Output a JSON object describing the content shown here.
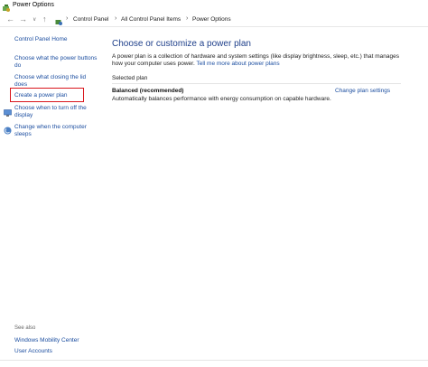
{
  "window": {
    "title": "Power Options"
  },
  "address": {
    "crumbs": [
      "Control Panel",
      "All Control Panel Items",
      "Power Options"
    ]
  },
  "sidebar": {
    "home": "Control Panel Home",
    "items": [
      {
        "label": "Choose what the power buttons do"
      },
      {
        "label": "Choose what closing the lid does"
      },
      {
        "label": "Create a power plan"
      },
      {
        "label": "Choose when to turn off the display"
      },
      {
        "label": "Change when the computer sleeps"
      }
    ],
    "see_also": {
      "heading": "See also",
      "links": [
        "Windows Mobility Center",
        "User Accounts"
      ]
    }
  },
  "main": {
    "title": "Choose or customize a power plan",
    "description": "A power plan is a collection of hardware and system settings (like display brightness, sleep, etc.) that manages how your computer uses power.",
    "description_link": "Tell me more about power plans",
    "group_label": "Selected plan",
    "plan": {
      "name": "Balanced (recommended)",
      "change_link": "Change plan settings",
      "description": "Automatically balances performance with energy consumption on capable hardware."
    }
  },
  "colors": {
    "link": "#1c4ea0",
    "title": "#1e3f8a",
    "highlight": "#d9161c"
  }
}
